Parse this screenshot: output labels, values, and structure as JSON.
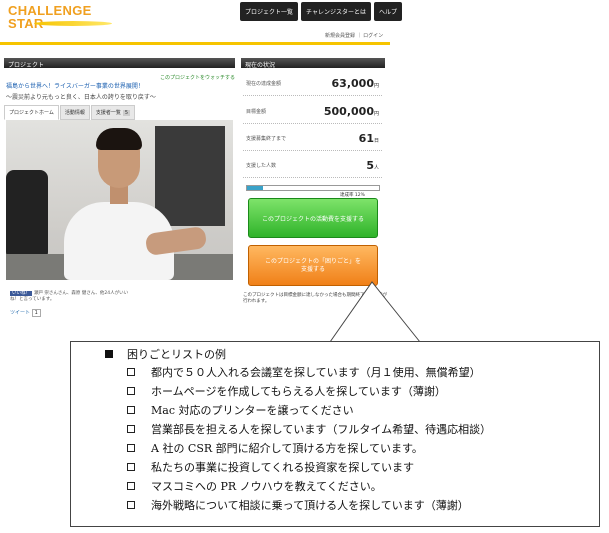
{
  "header": {
    "logo_line1": "CHALLENGE",
    "logo_line2": "STAR",
    "nav": [
      "プロジェクト一覧",
      "チャレンジスターとは",
      "ヘルプ"
    ],
    "login_links": "新規会員登録 ｜ ログイン"
  },
  "project": {
    "panel_title": "プロジェクト",
    "watch_link": "このプロジェクトをウォッチする",
    "title": "福島から世界へ！ライスバーガー事業の世界展開！",
    "subtitle": "〜震災前より元もっと良く、日本人の誇りを取り戻す〜",
    "tabs": [
      {
        "label": "プロジェクトホーム",
        "count": ""
      },
      {
        "label": "活動情報",
        "count": ""
      },
      {
        "label": "支援者一覧",
        "count": "5"
      }
    ],
    "like_text": "瀬戸 崇さんさん、森原 健さん、他24人がいいね！と言っています。",
    "like_label": "いいね！",
    "tweet_label": "ツイート",
    "tweet_count": "1"
  },
  "status": {
    "panel_title": "現在の状況",
    "stats": [
      {
        "label": "現在の達成金額",
        "value": "63,000",
        "unit": "円"
      },
      {
        "label": "目標金額",
        "value": "500,000",
        "unit": "円"
      },
      {
        "label": "支援募集終了まで",
        "value": "61",
        "unit": "日"
      },
      {
        "label": "支援した人数",
        "value": "5",
        "unit": "人"
      }
    ],
    "progress_fraction": 0.12,
    "rate_label": "達成率 12%",
    "support_button": "このプロジェクトの活動費を支援する",
    "help_button_line1": "このプロジェクトの「困りごと」を",
    "help_button_line2": "支援する",
    "note": "このプロジェクトは目標金額に達しなかった場合も期間終了後に決済が行われます。"
  },
  "callout": {
    "title": "困りごとリストの例",
    "items": [
      "都内で５０人入れる会議室を探しています（月１使用、無償希望）",
      "ホームページを作成してもらえる人を探しています（薄謝）",
      "Mac 対応のプリンターを譲ってください",
      "営業部長を担える人を探しています（フルタイム希望、待遇応相談）",
      "A 社の CSR 部門に紹介して頂ける方を探しています。",
      "私たちの事業に投資してくれる投資家を探しています",
      "マスコミへの PR ノウハウを教えてください。",
      "海外戦略について相談に乗って頂ける人を探しています（薄謝）"
    ]
  }
}
